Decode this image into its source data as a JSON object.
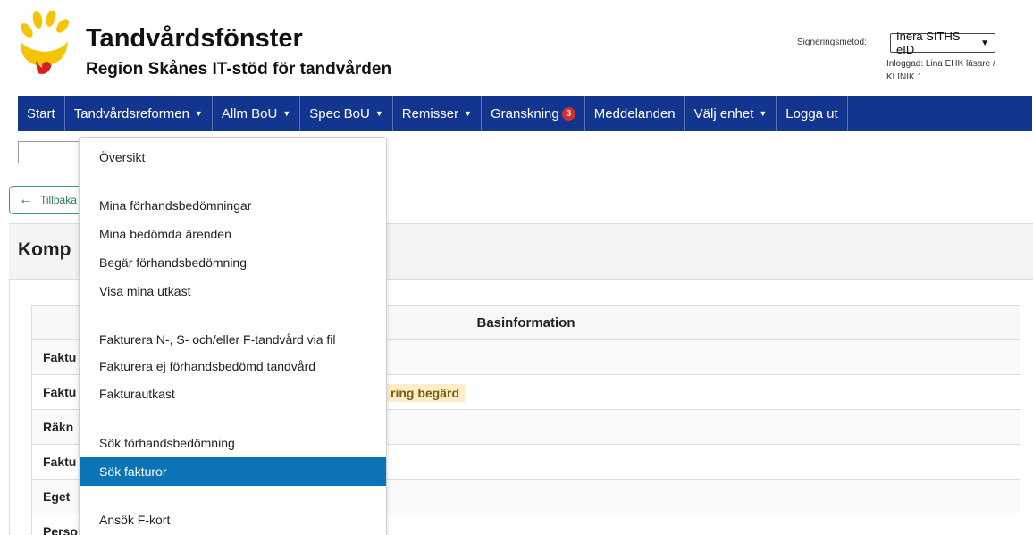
{
  "header": {
    "title": "Tandvårdsfönster",
    "subtitle": "Region Skånes IT-stöd för tandvården",
    "sign_label": "Signeringsmetod:",
    "sign_value": "Inera SITHS eID",
    "logged_in_line1": "Inloggad: Lina EHK läsare /",
    "logged_in_line2": "KLINIK 1"
  },
  "nav": {
    "items": [
      {
        "label": "Start"
      },
      {
        "label": "Tandvårdsreformen"
      },
      {
        "label": "Allm BoU"
      },
      {
        "label": "Spec BoU"
      },
      {
        "label": "Remisser"
      },
      {
        "label": "Granskning",
        "badge": "3"
      },
      {
        "label": "Meddelanden"
      },
      {
        "label": "Välj enhet"
      },
      {
        "label": "Logga ut"
      }
    ]
  },
  "back_button": "Tillbaka",
  "panel_title": "Komp",
  "table": {
    "header": "Basinformation",
    "rows": [
      "Faktu",
      "Faktu",
      "Räkn",
      "Faktu",
      "Eget",
      "Perso"
    ],
    "status_badge": "ring begärd"
  },
  "dropdown": {
    "items": [
      "Översikt",
      "Mina förhandsbedömningar",
      "Mina bedömda ärenden",
      "Begär förhandsbedömning",
      "Visa mina utkast",
      "Fakturera N-, S- och/eller F-tandvård via fil",
      "Fakturera ej förhandsbedömd tandvård",
      "Fakturautkast",
      "Sök förhandsbedömning",
      "Sök fakturor",
      "Ansök F-kort"
    ],
    "active_item": "Sök fakturor"
  },
  "colors": {
    "nav_bg": "#12358f",
    "active_menu": "#0b74b7",
    "badge": "#d32f2f",
    "logo_yellow": "#f5c400",
    "logo_red": "#d32020"
  }
}
